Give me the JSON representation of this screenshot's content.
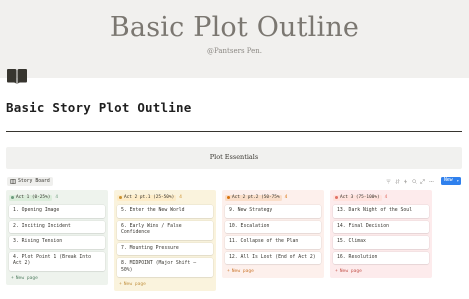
{
  "banner": {
    "title": "Basic Plot Outline",
    "subtitle": "@Pantsers Pen."
  },
  "page": {
    "icon": "book-icon",
    "title": "Basic Story Plot Outline"
  },
  "callout": {
    "text": "Plot Essentials"
  },
  "board": {
    "view_tab": "Story Board",
    "new_button": "New",
    "toolbar_icons": [
      "filter-icon",
      "sort-icon",
      "lightning-icon",
      "search-icon",
      "expand-icon",
      "more-icon"
    ],
    "columns": [
      {
        "label": "Act 1 (0-25%)",
        "count": "4",
        "colors": {
          "bg": "#eef3ed",
          "pill": "#dbeddb",
          "dot": "#6c9b7d",
          "new_page": "#548164"
        },
        "cards": [
          "1. Opening Image",
          "2. Inciting Incident",
          "3. Rising Tension",
          "4. Plot Point 1 (Break Into Act 2)"
        ],
        "new_page": "New page"
      },
      {
        "label": "Act 2 pt.1 (25-50%)",
        "count": "4",
        "colors": {
          "bg": "#faf3dd",
          "pill": "#fdecc8",
          "dot": "#cb912f",
          "new_page": "#c29343"
        },
        "cards": [
          "5. Enter the New World",
          "6. Early Wins / False Confidence",
          "7. Mounting Pressure",
          "8. MIDPOINT (Major Shift – 50%)"
        ],
        "new_page": "New page"
      },
      {
        "label": "Act 2 pt.2 (50-75%",
        "count": "4",
        "colors": {
          "bg": "#fdf0ec",
          "pill": "#fadec9",
          "dot": "#d9730d",
          "new_page": "#cc782f"
        },
        "cards": [
          "9. New Strategy",
          "10. Escalation",
          "11. Collapse of the Plan",
          "12. All Is Lost (End of Act 2)"
        ],
        "new_page": "New page"
      },
      {
        "label": "Act 3 (75-100%)",
        "count": "4",
        "colors": {
          "bg": "#fdebec",
          "pill": "#ffe2dd",
          "dot": "#e16f64",
          "new_page": "#c4554d"
        },
        "cards": [
          "13. Dark Night of the Soul",
          "14. Final Decision",
          "15. Climax",
          "16. Resolution"
        ],
        "new_page": "New page"
      }
    ]
  }
}
